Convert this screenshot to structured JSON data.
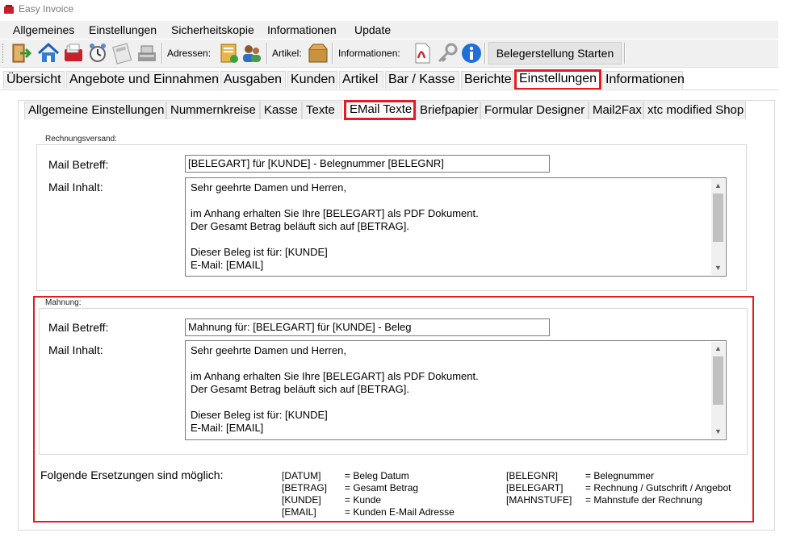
{
  "window": {
    "title": "Easy Invoice"
  },
  "menu": [
    "Allgemeines",
    "Einstellungen",
    "Sicherheitskopie",
    "Informationen",
    "Update"
  ],
  "toolbar": {
    "adressen_label": "Adressen:",
    "artikel_label": "Artikel:",
    "informationen_label": "Informationen:",
    "start_button": "Belegerstellung Starten"
  },
  "main_tabs": [
    "Übersicht",
    "Angebote und Einnahmen",
    "Ausgaben",
    "Kunden",
    "Artikel",
    "Bar / Kasse",
    "Berichte",
    "Einstellungen",
    "Informationen"
  ],
  "main_tabs_active": "Einstellungen",
  "sub_tabs": [
    "Allgemeine Einstellungen",
    "Nummernkreise",
    "Kasse",
    "Texte",
    "EMail Texte",
    "Briefpapier",
    "Formular Designer",
    "Mail2Fax",
    "xtc modified Shop"
  ],
  "sub_tabs_active": "EMail Texte",
  "rechnungsversand": {
    "group_label": "Rechnungsversand:",
    "betreff_label": "Mail Betreff:",
    "betreff_value": "[BELEGART] für [KUNDE] - Belegnummer [BELEGNR]",
    "inhalt_label": "Mail Inhalt:",
    "inhalt_lines": [
      "Sehr geehrte Damen und Herren,",
      "",
      "im Anhang erhalten Sie Ihre [BELEGART] als PDF Dokument.",
      "Der Gesamt Betrag beläuft sich auf [BETRAG].",
      "",
      "Dieser Beleg ist für: [KUNDE]",
      "E-Mail: [EMAIL]"
    ]
  },
  "mahnung": {
    "group_label": "Mahnung:",
    "betreff_label": "Mail Betreff:",
    "betreff_value": "Mahnung für: [BELEGART] für [KUNDE] - Beleg",
    "inhalt_label": "Mail Inhalt:",
    "inhalt_lines": [
      "Sehr geehrte Damen und Herren,",
      "",
      "im Anhang erhalten Sie Ihre [BELEGART] als PDF Dokument.",
      "Der Gesamt Betrag beläuft sich auf [BETRAG].",
      "",
      "Dieser Beleg ist für: [KUNDE]",
      "E-Mail: [EMAIL]"
    ]
  },
  "ersetzungen": {
    "title": "Folgende Ersetzungen sind möglich:",
    "left": [
      {
        "key": "[DATUM]",
        "desc": "= Beleg Datum"
      },
      {
        "key": "[BETRAG]",
        "desc": "= Gesamt Betrag"
      },
      {
        "key": "[KUNDE]",
        "desc": "= Kunde"
      },
      {
        "key": "[EMAIL]",
        "desc": "= Kunden E-Mail Adresse"
      }
    ],
    "right": [
      {
        "key": "[BELEGNR]",
        "desc": "= Belegnummer"
      },
      {
        "key": "[BELEGART]",
        "desc": "= Rechnung / Gutschrift / Angebot"
      },
      {
        "key": "[MAHNSTUFE]",
        "desc": "= Mahnstufe der Rechnung"
      }
    ]
  },
  "colors": {
    "highlight": "#e21b24",
    "chrome": "#f0f0f0"
  },
  "icons": [
    "exit-door-icon",
    "home-icon",
    "mail-bag-icon",
    "alarm-clock-icon",
    "calculator-icon",
    "cash-register-icon",
    "address-book-icon",
    "users-icon",
    "box-icon",
    "pdf-icon",
    "key-icon",
    "info-icon"
  ]
}
